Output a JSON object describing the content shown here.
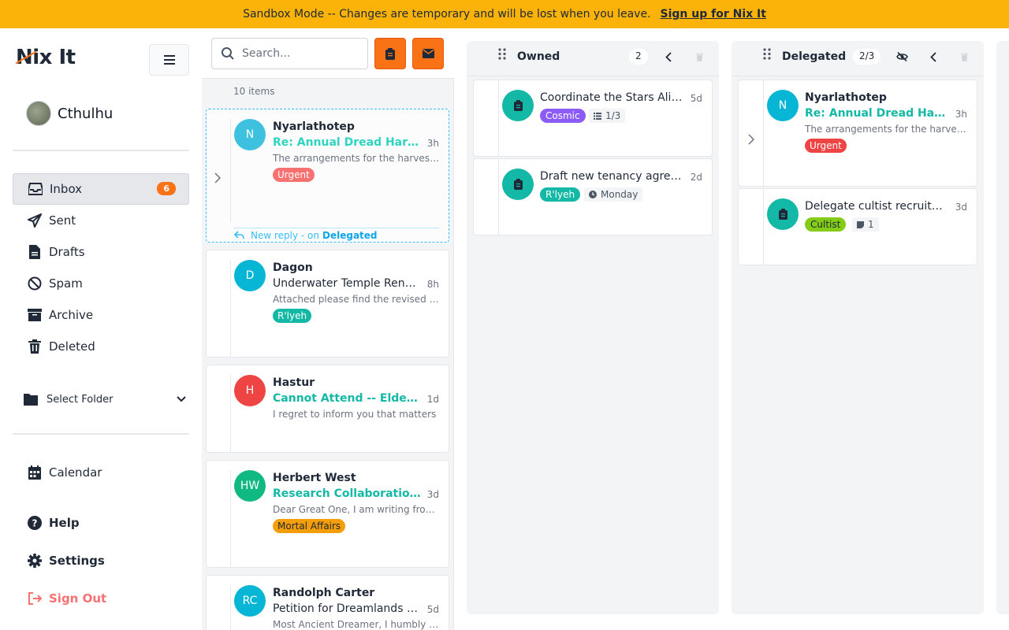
{
  "banner": {
    "message": "Sandbox Mode -- Changes are temporary and will be lost when you leave.",
    "link": "Sign up for Nix It"
  },
  "app": {
    "logo": "Nix It"
  },
  "user": {
    "name": "Cthulhu"
  },
  "nav": {
    "inbox": "Inbox",
    "inbox_count": "6",
    "sent": "Sent",
    "drafts": "Drafts",
    "spam": "Spam",
    "archive": "Archive",
    "deleted": "Deleted",
    "select_folder": "Select Folder",
    "calendar": "Calendar",
    "help": "Help",
    "settings": "Settings",
    "sign_out": "Sign Out"
  },
  "mail_list": {
    "search_placeholder": "Search...",
    "count": "10 items",
    "reply_note": "New reply - on",
    "reply_target": "Delegated",
    "items": [
      {
        "initials": "N",
        "sender": "Nyarlathotep",
        "subject": "Re: Annual Dread Harvest",
        "time": "3h",
        "preview": "The arrangements for the harvest are",
        "tag": "Urgent",
        "avatar_color": "#3ec1df",
        "tag_color": "#f87171"
      },
      {
        "initials": "D",
        "sender": "Dagon",
        "subject": "Underwater Temple Renovations",
        "time": "8h",
        "preview": "Attached please find the revised plans",
        "tag": "R'lyeh",
        "avatar_color": "#06b6d4",
        "tag_color": "#14b8a6"
      },
      {
        "initials": "H",
        "sender": "Hastur",
        "subject": "Cannot Attend -- Elder Gathering",
        "time": "1d",
        "preview": "I regret to inform you that matters",
        "tag": "",
        "avatar_color": "#ef4444",
        "tag_color": ""
      },
      {
        "initials": "HW",
        "sender": "Herbert West",
        "subject": "Research Collaboration Proposal",
        "time": "3d",
        "preview": "Dear Great One, I am writing from the",
        "tag": "Mortal Affairs",
        "avatar_color": "#10b981",
        "tag_color": "#f59e0b"
      },
      {
        "initials": "RC",
        "sender": "Randolph Carter",
        "subject": "Petition for Dreamlands Access",
        "time": "5d",
        "preview": "Most Ancient Dreamer, I humbly request",
        "tag": "",
        "avatar_color": "#06b6d4",
        "tag_color": ""
      }
    ]
  },
  "board": {
    "owned": {
      "title": "Owned",
      "count": "2",
      "cards": [
        {
          "title": "Coordinate the Stars Alignment",
          "time": "5d",
          "tag": "Cosmic",
          "tag_color": "#8b5cf6",
          "meta": "1/3"
        },
        {
          "title": "Draft new tenancy agreement",
          "time": "2d",
          "tag": "R'lyeh",
          "tag_color": "#14b8a6",
          "meta": "Monday"
        }
      ]
    },
    "delegated": {
      "title": "Delegated",
      "count": "2/3",
      "cards": [
        {
          "initials": "N",
          "sender": "Nyarlathotep",
          "subject": "Re: Annual Dread Harvest",
          "time": "3h",
          "preview": "The arrangements for the harvest are",
          "tag": "Urgent",
          "tag_color": "#ef4444"
        },
        {
          "title": "Delegate cultist recruitment",
          "time": "3d",
          "tag": "Cultist",
          "tag_color": "#84cc16",
          "meta": "1"
        }
      ]
    }
  }
}
